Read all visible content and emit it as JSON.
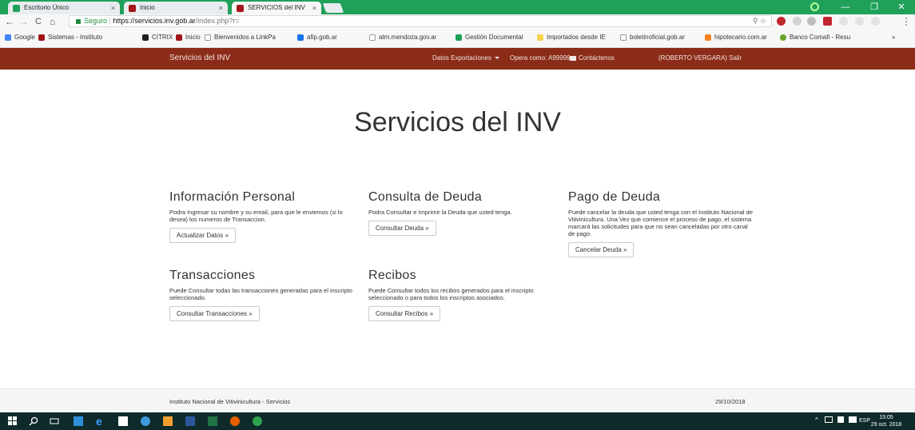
{
  "browser": {
    "tabs": [
      {
        "title": "Escritorio Único",
        "active": false
      },
      {
        "title": "Inicio",
        "active": false
      },
      {
        "title": "SERVICIOS del INV",
        "active": true
      }
    ],
    "tab_close_glyph": "×",
    "window_controls": {
      "minimize": "—",
      "maximize": "❐",
      "close": "✕"
    },
    "address": {
      "secure_label": "Seguro",
      "url_main": "https://servicios.inv.gob.ar",
      "url_rest": "/index.php?r=",
      "search_glyph": "⚲",
      "star_glyph": "☆"
    },
    "nav_glyphs": {
      "back": "←",
      "forward": "→",
      "reload": "C",
      "home": "⌂",
      "menu": "⋮"
    },
    "bookmarks": [
      {
        "label": "Google",
        "icon": "google-icon"
      },
      {
        "label": "Sistemas - Instituto",
        "icon": "inv-icon"
      },
      {
        "label": "CITRIX",
        "icon": "citrix-icon"
      },
      {
        "label": "Inicio",
        "icon": "inv-icon"
      },
      {
        "label": "Bienvenidos a LinkPa",
        "icon": "page-icon"
      },
      {
        "label": "afip.gob.ar",
        "icon": "afip-icon"
      },
      {
        "label": "atm.mendoza.gov.ar",
        "icon": "page-icon"
      },
      {
        "label": "Gestión Documental",
        "icon": "gde-icon"
      },
      {
        "label": "Importados desde IE",
        "icon": "folder-icon"
      },
      {
        "label": "boletinoficial.gob.ar",
        "icon": "page-icon"
      },
      {
        "label": "hipotecario.com.ar",
        "icon": "bank-icon"
      },
      {
        "label": "Banco Comafi - Resu",
        "icon": "comafi-icon"
      }
    ],
    "bookmarks_overflow": "»"
  },
  "navbar": {
    "brand": "Servicios del INV",
    "datos_exportaciones": "Datos Exportaciones",
    "opera_como": "Opera como: A99999",
    "contactenos": "Contáctenos",
    "salir": "(ROBERTO VERGARA) Salir"
  },
  "main": {
    "title": "Servicios del INV",
    "cards": [
      {
        "title": "Información Personal",
        "text": "Podra Ingresar su nombre y su email, para que le enviemos (si lo desea) los numeros de Transaccion.",
        "button": "Actualizar Datos »"
      },
      {
        "title": "Consulta de Deuda",
        "text": "Podra Consultar e Imprimir la Deuda que usted tenga.",
        "button": "Consultar Deuda »"
      },
      {
        "title": "Pago de Deuda",
        "text": "Puede cancelar la deuda que usted tenga con el Instituto Nacional de Vitivinicultura. Una Vez que comience el proceso de pago, el sistema marcará las solicitudes para que no sean canceladas por otro canal de pago",
        "button": "Cancelar Deuda »"
      },
      {
        "title": "Transacciones",
        "text": "Puede Consultar todas las transacciones generadas para el inscripto seleccionado.",
        "button": "Consultar Transacciones »"
      },
      {
        "title": "Recibos",
        "text": "Puede Consultar todos los recibos generados para el inscripto seleccionado o para todos los inscriptos asociados.",
        "button": "Consultar Recibos »"
      }
    ]
  },
  "footer": {
    "left": "Instituto Nacional de Vitivinicultura - Servicios",
    "right": "29/10/2018"
  },
  "taskbar": {
    "tray_caret": "^",
    "language": "ESP",
    "time": "15:05",
    "date": "29 oct. 2018"
  },
  "colors": {
    "tabstrip": "#1fa15a",
    "navbar": "#8b2c19",
    "taskbar": "#0f2a2a"
  }
}
